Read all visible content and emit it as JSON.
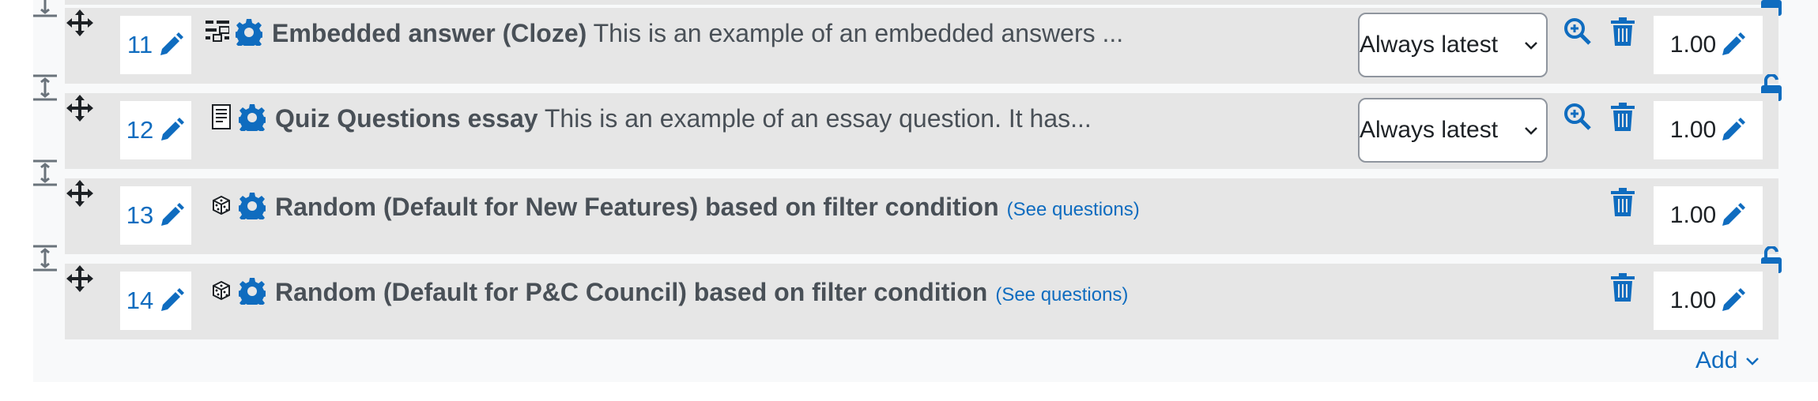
{
  "questions": [
    {
      "number": "11",
      "type_icon": "cloze-icon",
      "title": "Embedded answer (Cloze)",
      "description": "This is an example of an embedded answers ...",
      "version": "Always latest",
      "mark": "1.00",
      "has_preview": true
    },
    {
      "number": "12",
      "type_icon": "essay-icon",
      "title": "Quiz Questions essay",
      "description": "This is an example of an essay question. It has...",
      "version": "Always latest",
      "mark": "1.00",
      "has_preview": true
    },
    {
      "number": "13",
      "type_icon": "random-icon",
      "title": "Random (Default for New Features) based on filter condition",
      "see_questions": "(See questions)",
      "mark": "1.00"
    },
    {
      "number": "14",
      "type_icon": "random-icon",
      "title": "Random (Default for P&C Council) based on filter condition",
      "see_questions": "(See questions)",
      "mark": "1.00"
    }
  ],
  "add_label": "Add",
  "colors": {
    "accent": "#0f6cbf",
    "row_bg": "#e6e6e6",
    "panel_bg": "#f8f9fa",
    "icon_dark": "#1d2125"
  }
}
